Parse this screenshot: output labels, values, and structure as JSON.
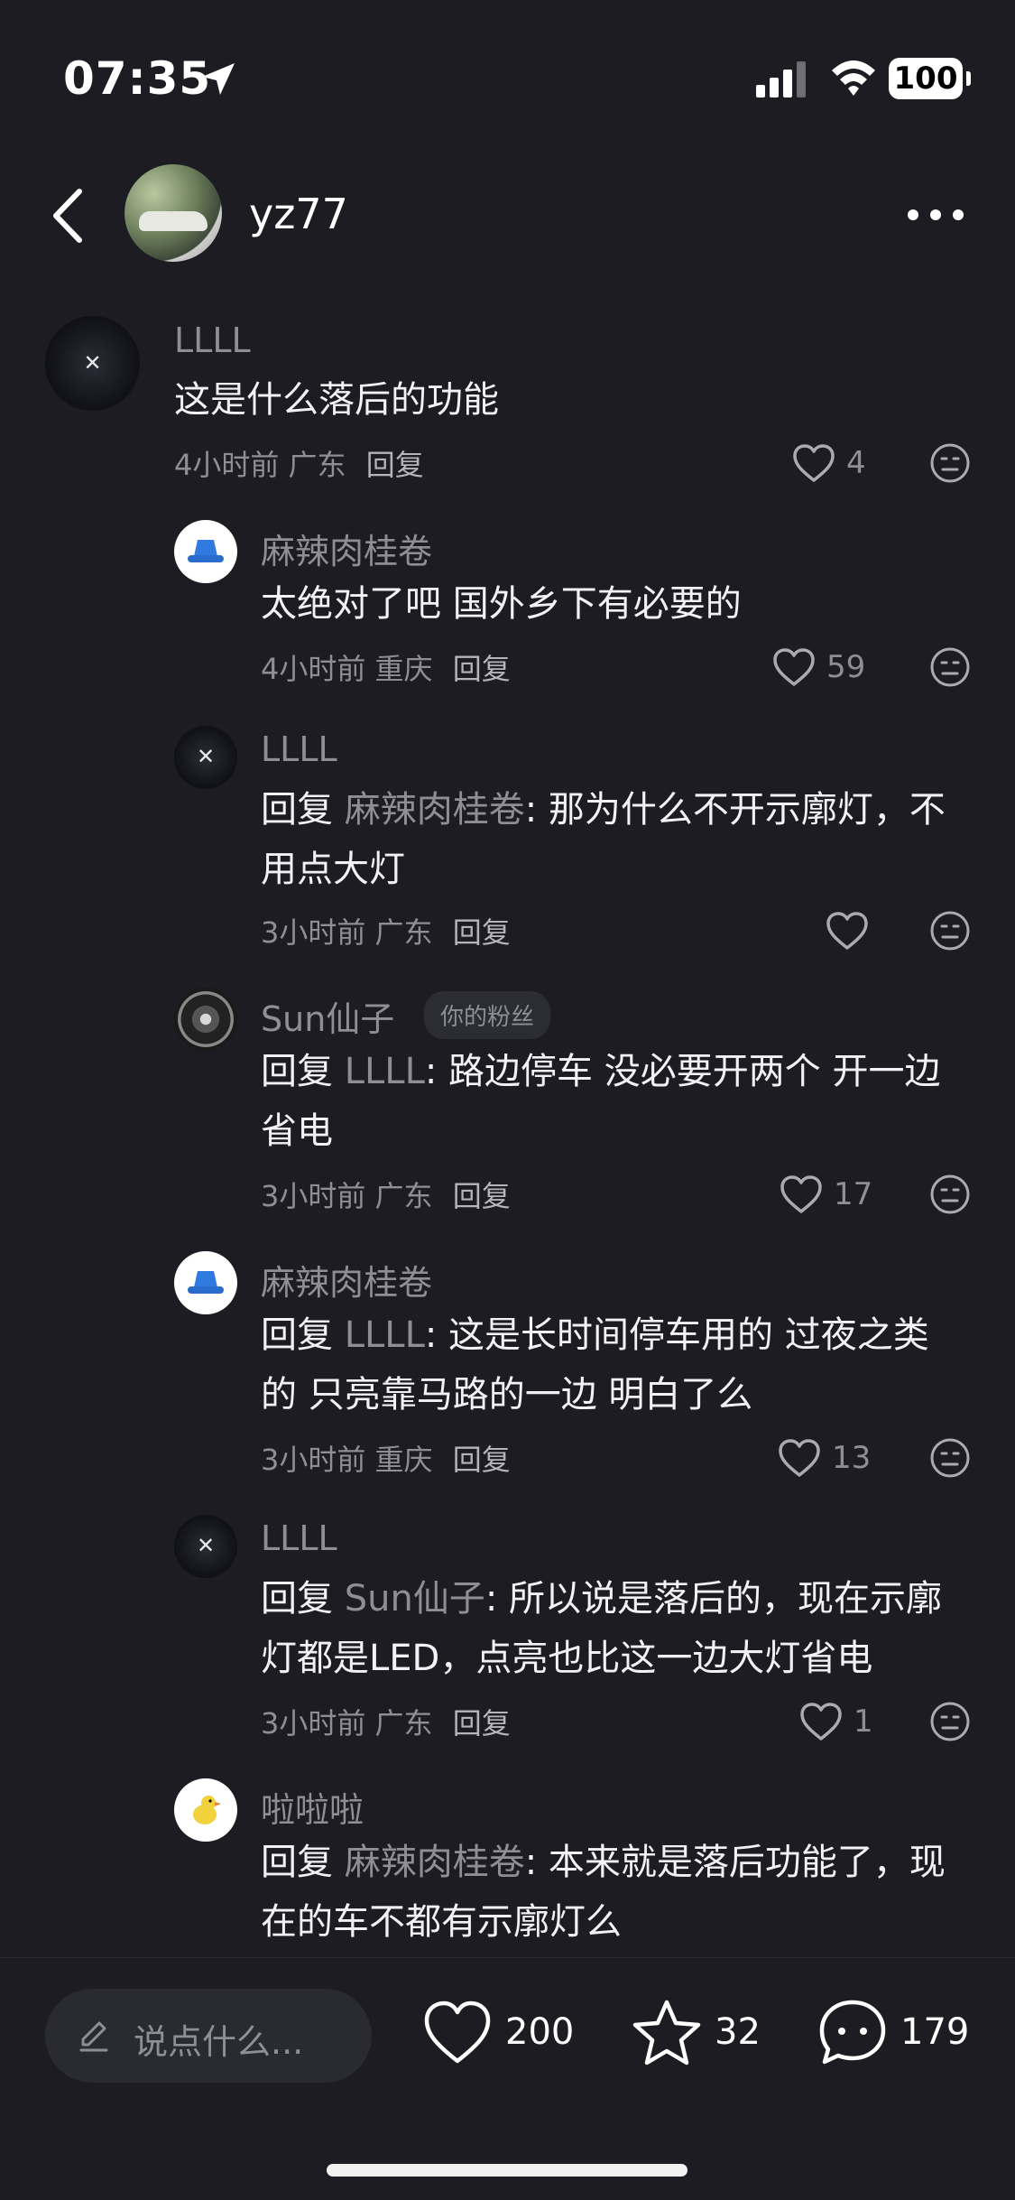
{
  "status_bar": {
    "time": "07:35",
    "battery": "100"
  },
  "header": {
    "username": "yz77"
  },
  "comments": [
    {
      "name": "LLLL",
      "text": "这是什么落后的功能",
      "time": "4小时前",
      "location": "广东",
      "reply_label": "回复",
      "likes": "4"
    },
    {
      "name": "麻辣肉桂卷",
      "text": "太绝对了吧 国外乡下有必要的",
      "time": "4小时前",
      "location": "重庆",
      "reply_label": "回复",
      "likes": "59"
    },
    {
      "name": "LLLL",
      "reply_prefix": "回复 ",
      "mention": "麻辣肉桂卷",
      "line1": ": 那为什么不开示廓灯，不",
      "line2": "用点大灯",
      "time": "3小时前",
      "location": "广东",
      "reply_label": "回复",
      "likes": ""
    },
    {
      "name": "Sun仙子",
      "badge": "你的粉丝",
      "reply_prefix": "回复 ",
      "mention": "LLLL",
      "line1": ": 路边停车 没必要开两个 开一边",
      "line2": "省电",
      "time": "3小时前",
      "location": "广东",
      "reply_label": "回复",
      "likes": "17"
    },
    {
      "name": "麻辣肉桂卷",
      "reply_prefix": "回复 ",
      "mention": "LLLL",
      "line1": ": 这是长时间停车用的 过夜之类",
      "line2": "的 只亮靠马路的一边 明白了么",
      "time": "3小时前",
      "location": "重庆",
      "reply_label": "回复",
      "likes": "13"
    },
    {
      "name": "LLLL",
      "reply_prefix": "回复 ",
      "mention": "Sun仙子",
      "line1": ": 所以说是落后的，现在示廓",
      "line2": "灯都是LED，点亮也比这一边大灯省电",
      "time": "3小时前",
      "location": "广东",
      "reply_label": "回复",
      "likes": "1"
    },
    {
      "name": "啦啦啦",
      "reply_prefix": "回复 ",
      "mention": "麻辣肉桂卷",
      "line1": ": 本来就是落后功能了，现",
      "line2": "在的车不都有示廓灯么"
    }
  ],
  "bottom_bar": {
    "input_placeholder": "说点什么...",
    "likes": "200",
    "favorites": "32",
    "comments": "179"
  }
}
